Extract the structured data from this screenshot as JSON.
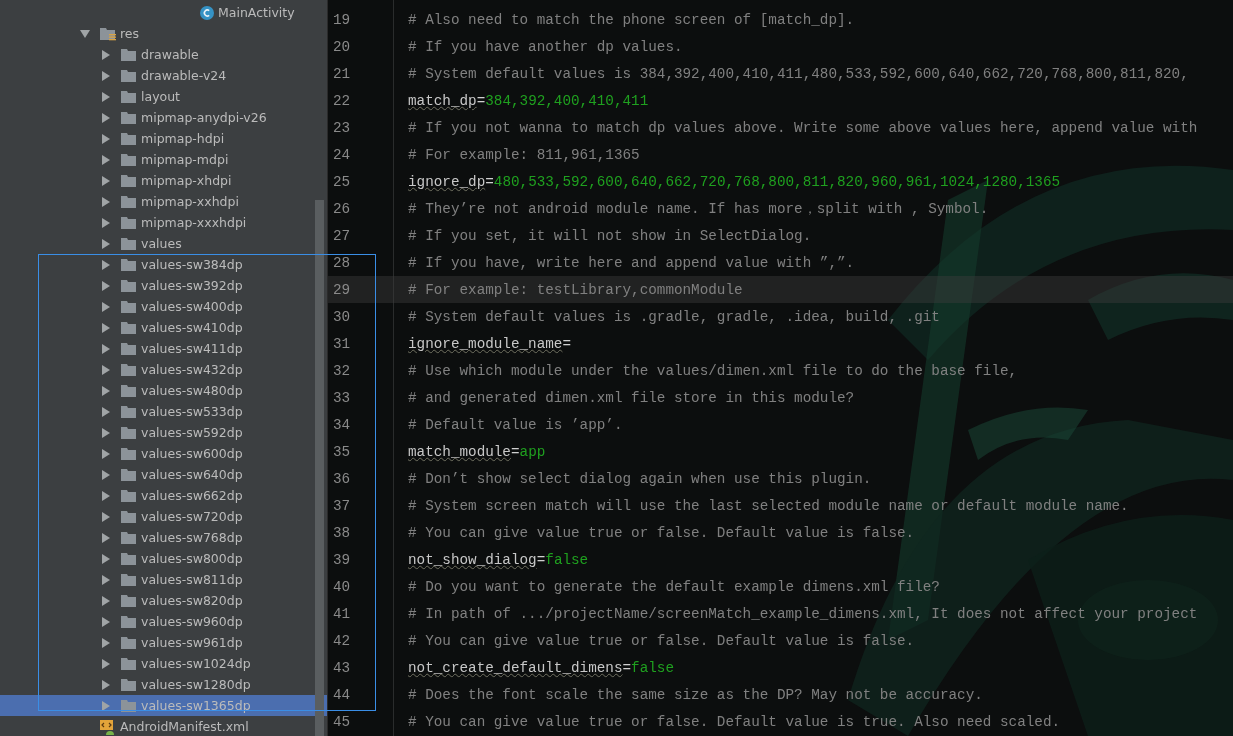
{
  "project_tree": [
    {
      "label": "MainActivity",
      "kind": "class"
    },
    {
      "label": "res",
      "kind": "res-folder",
      "expanded": true,
      "selected": false,
      "children": [
        {
          "label": "drawable",
          "kind": "folder",
          "expanded": false,
          "selected": false
        },
        {
          "label": "drawable-v24",
          "kind": "folder",
          "expanded": false,
          "selected": false
        },
        {
          "label": "layout",
          "kind": "folder",
          "expanded": false,
          "selected": false
        },
        {
          "label": "mipmap-anydpi-v26",
          "kind": "folder",
          "expanded": false,
          "selected": false
        },
        {
          "label": "mipmap-hdpi",
          "kind": "folder",
          "expanded": false,
          "selected": false
        },
        {
          "label": "mipmap-mdpi",
          "kind": "folder",
          "expanded": false,
          "selected": false
        },
        {
          "label": "mipmap-xhdpi",
          "kind": "folder",
          "expanded": false,
          "selected": false
        },
        {
          "label": "mipmap-xxhdpi",
          "kind": "folder",
          "expanded": false,
          "selected": false
        },
        {
          "label": "mipmap-xxxhdpi",
          "kind": "folder",
          "expanded": false,
          "selected": false
        },
        {
          "label": "values",
          "kind": "folder",
          "expanded": false,
          "selected": false
        },
        {
          "label": "values-sw384dp",
          "kind": "folder",
          "expanded": false,
          "selected": false
        },
        {
          "label": "values-sw392dp",
          "kind": "folder",
          "expanded": false,
          "selected": false
        },
        {
          "label": "values-sw400dp",
          "kind": "folder",
          "expanded": false,
          "selected": false
        },
        {
          "label": "values-sw410dp",
          "kind": "folder",
          "expanded": false,
          "selected": false
        },
        {
          "label": "values-sw411dp",
          "kind": "folder",
          "expanded": false,
          "selected": false
        },
        {
          "label": "values-sw432dp",
          "kind": "folder",
          "expanded": false,
          "selected": false
        },
        {
          "label": "values-sw480dp",
          "kind": "folder",
          "expanded": false,
          "selected": false
        },
        {
          "label": "values-sw533dp",
          "kind": "folder",
          "expanded": false,
          "selected": false
        },
        {
          "label": "values-sw592dp",
          "kind": "folder",
          "expanded": false,
          "selected": false
        },
        {
          "label": "values-sw600dp",
          "kind": "folder",
          "expanded": false,
          "selected": false
        },
        {
          "label": "values-sw640dp",
          "kind": "folder",
          "expanded": false,
          "selected": false
        },
        {
          "label": "values-sw662dp",
          "kind": "folder",
          "expanded": false,
          "selected": false
        },
        {
          "label": "values-sw720dp",
          "kind": "folder",
          "expanded": false,
          "selected": false
        },
        {
          "label": "values-sw768dp",
          "kind": "folder",
          "expanded": false,
          "selected": false
        },
        {
          "label": "values-sw800dp",
          "kind": "folder",
          "expanded": false,
          "selected": false
        },
        {
          "label": "values-sw811dp",
          "kind": "folder",
          "expanded": false,
          "selected": false
        },
        {
          "label": "values-sw820dp",
          "kind": "folder",
          "expanded": false,
          "selected": false
        },
        {
          "label": "values-sw960dp",
          "kind": "folder",
          "expanded": false,
          "selected": false
        },
        {
          "label": "values-sw961dp",
          "kind": "folder",
          "expanded": false,
          "selected": false
        },
        {
          "label": "values-sw1024dp",
          "kind": "folder",
          "expanded": false,
          "selected": false
        },
        {
          "label": "values-sw1280dp",
          "kind": "folder",
          "expanded": false,
          "selected": false
        },
        {
          "label": "values-sw1365dp",
          "kind": "folder",
          "expanded": false,
          "selected": true
        }
      ]
    },
    {
      "label": "AndroidManifest.xml",
      "kind": "manifest"
    }
  ],
  "editor": {
    "lines": [
      {
        "number": "19",
        "kind": "comment",
        "text": "# Also need to match the phone screen of [match_dp].",
        "current": false
      },
      {
        "number": "20",
        "kind": "comment",
        "text": "# If you have another dp values.",
        "current": false
      },
      {
        "number": "21",
        "kind": "comment",
        "text": "# System default values is 384,392,400,410,411,480,533,592,600,640,662,720,768,800,811,820,",
        "current": false
      },
      {
        "number": "22",
        "kind": "property",
        "key": "match_dp",
        "op": "=",
        "value": "384,392,400,410,411",
        "current": false
      },
      {
        "number": "23",
        "kind": "comment",
        "text": "# If you not wanna to match dp values above. Write some above values here, append value with",
        "current": false
      },
      {
        "number": "24",
        "kind": "comment",
        "text": "# For example: 811,961,1365",
        "current": false
      },
      {
        "number": "25",
        "kind": "property",
        "key": "ignore_dp",
        "op": "=",
        "value": "480,533,592,600,640,662,720,768,800,811,820,960,961,1024,1280,1365",
        "current": false
      },
      {
        "number": "26",
        "kind": "comment",
        "text": "# They’re not android module name. If has more，split with , Symbol.",
        "current": false
      },
      {
        "number": "27",
        "kind": "comment",
        "text": "# If you set, it will not show in SelectDialog.",
        "current": false
      },
      {
        "number": "28",
        "kind": "comment",
        "text": "# If you have, write here and append value with ”,”.",
        "current": false
      },
      {
        "number": "29",
        "kind": "comment",
        "text": "# For example: testLibrary,commonModule",
        "current": true
      },
      {
        "number": "30",
        "kind": "comment",
        "text": "# System default values is .gradle, gradle, .idea, build, .git",
        "current": false
      },
      {
        "number": "31",
        "kind": "property",
        "key": "ignore_module_name",
        "op": "=",
        "current": false
      },
      {
        "number": "32",
        "kind": "comment",
        "text": "# Use which module under the values/dimen.xml file to do the base file,",
        "current": false
      },
      {
        "number": "33",
        "kind": "comment",
        "text": "# and generated dimen.xml file store in this module?",
        "current": false
      },
      {
        "number": "34",
        "kind": "comment",
        "text": "# Default value is ’app’.",
        "current": false
      },
      {
        "number": "35",
        "kind": "property",
        "key": "match_module",
        "op": "=",
        "value": "app",
        "current": false
      },
      {
        "number": "36",
        "kind": "comment",
        "text": "# Don’t show select dialog again when use this plugin.",
        "current": false
      },
      {
        "number": "37",
        "kind": "comment",
        "text": "# System screen match will use the last selected module name or default module name.",
        "current": false
      },
      {
        "number": "38",
        "kind": "comment",
        "text": "# You can give value true or false. Default value is false.",
        "current": false
      },
      {
        "number": "39",
        "kind": "property",
        "key": "not_show_dialog",
        "op": "=",
        "value": "false",
        "current": false
      },
      {
        "number": "40",
        "kind": "comment",
        "text": "# Do you want to generate the default example dimens.xml file?",
        "current": false
      },
      {
        "number": "41",
        "kind": "comment",
        "text": "# In path of .../projectName/screenMatch_example_dimens.xml, It does not affect your project",
        "current": false
      },
      {
        "number": "42",
        "kind": "comment",
        "text": "# You can give value true or false. Default value is false.",
        "current": false
      },
      {
        "number": "43",
        "kind": "property",
        "key": "not_create_default_dimens",
        "op": "=",
        "value": "false",
        "current": false
      },
      {
        "number": "44",
        "kind": "comment",
        "text": "# Does the font scale the same size as the DP? May not be accuracy.",
        "current": false
      },
      {
        "number": "45",
        "kind": "comment",
        "text": "# You can give value true or false. Default value is true. Also need scaled.",
        "current": false
      }
    ]
  }
}
